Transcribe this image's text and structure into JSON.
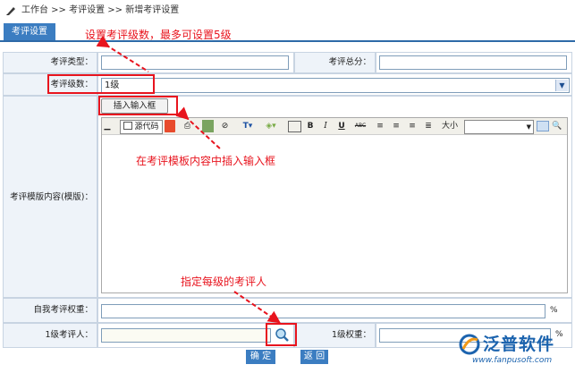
{
  "breadcrumb": {
    "text": "工作台 >> 考评设置 >> 新增考评设置"
  },
  "tab": {
    "label": "考评设置"
  },
  "annotations": {
    "levels": "设置考评级数，最多可设置5级",
    "insert": "在考评模板内容中插入输入框",
    "evaluator": "指定每级的考评人"
  },
  "form": {
    "type_label": "考评类型：",
    "type_value": "",
    "total_label": "考评总分：",
    "total_value": "",
    "levels_label": "考评级数：",
    "levels_value": "1级",
    "template_label": "考评模版内容(模版)：",
    "insert_button": "插入输入框",
    "self_weight_label": "自我考评权重：",
    "self_weight_value": "",
    "percent": "%",
    "level1_evaluator_label": "1级考评人：",
    "level1_weight_label": "1级权重：",
    "level1_percent": "%"
  },
  "editor_toolbar": {
    "source": "源代码",
    "bold": "B",
    "italic": "I",
    "underline": "U",
    "strike": "ABC",
    "size": "大小"
  },
  "buttons": {
    "confirm": "确 定",
    "back": "返 回"
  },
  "watermark": {
    "brand": "泛普软件",
    "url": "www.fanpusoft.com"
  },
  "colors": {
    "accent": "#3b7dc1",
    "annotation": "#e8141e"
  }
}
